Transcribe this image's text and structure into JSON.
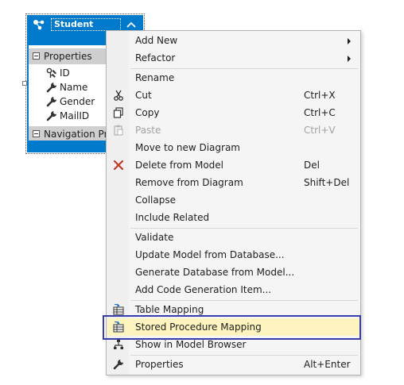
{
  "entity": {
    "title": "Student",
    "properties_label": "Properties",
    "properties": [
      {
        "name": "ID",
        "icon": "key-wrench-icon"
      },
      {
        "name": "Name",
        "icon": "wrench-icon"
      },
      {
        "name": "Gender",
        "icon": "wrench-icon"
      },
      {
        "name": "MailID",
        "icon": "wrench-icon"
      }
    ],
    "navigation_label": "Navigation Pro"
  },
  "menu": {
    "items": [
      {
        "label": "Add New",
        "submenu": true
      },
      {
        "label": "Refactor",
        "submenu": true
      },
      {
        "label": "Rename"
      },
      {
        "label": "Cut",
        "shortcut": "Ctrl+X",
        "icon": "scissors-icon"
      },
      {
        "label": "Copy",
        "shortcut": "Ctrl+C",
        "icon": "copy-icon"
      },
      {
        "label": "Paste",
        "shortcut": "Ctrl+V",
        "icon": "paste-icon",
        "disabled": true
      },
      {
        "label": "Move to new Diagram"
      },
      {
        "label": "Delete from Model",
        "shortcut": "Del",
        "icon": "delete-x-icon"
      },
      {
        "label": "Remove from Diagram",
        "shortcut": "Shift+Del"
      },
      {
        "label": "Collapse"
      },
      {
        "label": "Include Related"
      },
      {
        "label": "Validate"
      },
      {
        "label": "Update Model from Database..."
      },
      {
        "label": "Generate Database from Model..."
      },
      {
        "label": "Add Code Generation Item..."
      },
      {
        "label": "Table Mapping",
        "icon": "table-mapping-icon"
      },
      {
        "label": "Stored Procedure Mapping",
        "icon": "stored-procedure-icon",
        "highlighted": true
      },
      {
        "label": "Show in Model Browser",
        "icon": "model-browser-icon"
      },
      {
        "label": "Properties",
        "shortcut": "Alt+Enter",
        "icon": "wrench-icon"
      }
    ]
  },
  "colors": {
    "entity_blue": "#007acc",
    "highlight_border": "#3b3da6",
    "hover_fill": "#fdf4bf",
    "delete_red": "#c0392b"
  }
}
